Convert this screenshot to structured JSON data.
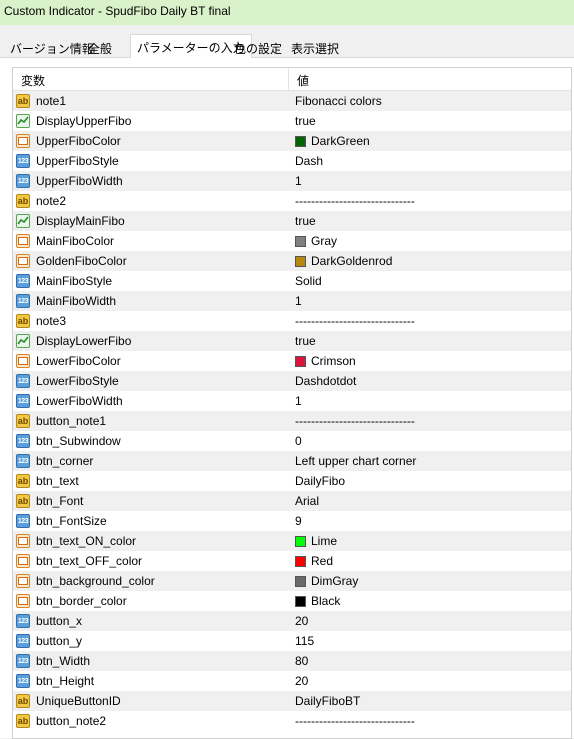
{
  "window": {
    "title": "Custom Indicator - SpudFibo Daily BT final"
  },
  "tabs": [
    {
      "label": "バージョン情報",
      "active": false
    },
    {
      "label": "全般",
      "active": false
    },
    {
      "label": "パラメーターの入力",
      "active": true
    },
    {
      "label": "色の設定",
      "active": false
    },
    {
      "label": "表示選択",
      "active": false
    }
  ],
  "table": {
    "col_variable": "変数",
    "col_value": "値",
    "rows": [
      {
        "type": "string",
        "icon": "string-icon",
        "name": "note1",
        "value": "Fibonacci colors"
      },
      {
        "type": "bool",
        "icon": "bool-icon",
        "name": "DisplayUpperFibo",
        "value": "true"
      },
      {
        "type": "color",
        "icon": "color-icon",
        "name": "UpperFiboColor",
        "value": "DarkGreen",
        "swatch": "#006400"
      },
      {
        "type": "int",
        "icon": "int-icon",
        "name": "UpperFiboStyle",
        "value": "Dash"
      },
      {
        "type": "int",
        "icon": "int-icon",
        "name": "UpperFiboWidth",
        "value": "1"
      },
      {
        "type": "string",
        "icon": "string-icon",
        "name": "note2",
        "value": "------------------------------"
      },
      {
        "type": "bool",
        "icon": "bool-icon",
        "name": "DisplayMainFibo",
        "value": "true"
      },
      {
        "type": "color",
        "icon": "color-icon",
        "name": "MainFiboColor",
        "value": "Gray",
        "swatch": "#808080"
      },
      {
        "type": "color",
        "icon": "color-icon",
        "name": "GoldenFiboColor",
        "value": "DarkGoldenrod",
        "swatch": "#B8860B"
      },
      {
        "type": "int",
        "icon": "int-icon",
        "name": "MainFiboStyle",
        "value": "Solid"
      },
      {
        "type": "int",
        "icon": "int-icon",
        "name": "MainFiboWidth",
        "value": "1"
      },
      {
        "type": "string",
        "icon": "string-icon",
        "name": "note3",
        "value": "------------------------------"
      },
      {
        "type": "bool",
        "icon": "bool-icon",
        "name": "DisplayLowerFibo",
        "value": "true"
      },
      {
        "type": "color",
        "icon": "color-icon",
        "name": "LowerFiboColor",
        "value": "Crimson",
        "swatch": "#DC143C"
      },
      {
        "type": "int",
        "icon": "int-icon",
        "name": "LowerFiboStyle",
        "value": "Dashdotdot"
      },
      {
        "type": "int",
        "icon": "int-icon",
        "name": "LowerFiboWidth",
        "value": "1"
      },
      {
        "type": "string",
        "icon": "string-icon",
        "name": "button_note1",
        "value": "------------------------------"
      },
      {
        "type": "int",
        "icon": "int-icon",
        "name": "btn_Subwindow",
        "value": "0"
      },
      {
        "type": "int",
        "icon": "int-icon",
        "name": "btn_corner",
        "value": "Left upper chart corner"
      },
      {
        "type": "string",
        "icon": "string-icon",
        "name": "btn_text",
        "value": "DailyFibo"
      },
      {
        "type": "string",
        "icon": "string-icon",
        "name": "btn_Font",
        "value": "Arial"
      },
      {
        "type": "int",
        "icon": "int-icon",
        "name": "btn_FontSize",
        "value": "9"
      },
      {
        "type": "color",
        "icon": "color-icon",
        "name": "btn_text_ON_color",
        "value": "Lime",
        "swatch": "#00FF00"
      },
      {
        "type": "color",
        "icon": "color-icon",
        "name": "btn_text_OFF_color",
        "value": "Red",
        "swatch": "#FF0000"
      },
      {
        "type": "color",
        "icon": "color-icon",
        "name": "btn_background_color",
        "value": "DimGray",
        "swatch": "#696969"
      },
      {
        "type": "color",
        "icon": "color-icon",
        "name": "btn_border_color",
        "value": "Black",
        "swatch": "#000000"
      },
      {
        "type": "int",
        "icon": "int-icon",
        "name": "button_x",
        "value": "20"
      },
      {
        "type": "int",
        "icon": "int-icon",
        "name": "button_y",
        "value": "115"
      },
      {
        "type": "int",
        "icon": "int-icon",
        "name": "btn_Width",
        "value": "80"
      },
      {
        "type": "int",
        "icon": "int-icon",
        "name": "btn_Height",
        "value": "20"
      },
      {
        "type": "string",
        "icon": "string-icon",
        "name": "UniqueButtonID",
        "value": "DailyFiboBT"
      },
      {
        "type": "string",
        "icon": "string-icon",
        "name": "button_note2",
        "value": "------------------------------"
      }
    ]
  }
}
